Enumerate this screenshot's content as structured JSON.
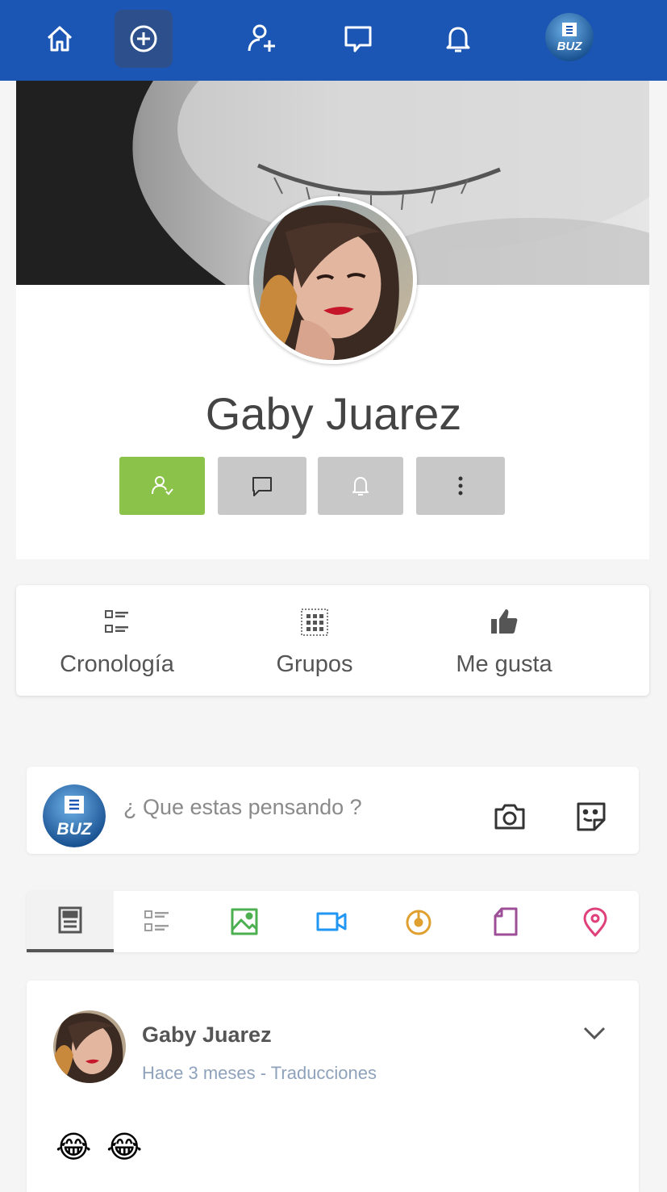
{
  "topbar": {
    "icons": [
      "home-icon",
      "add-circle-icon",
      "add-user-icon",
      "messages-icon",
      "bell-icon",
      "avatar"
    ],
    "accent": "#1c56b4"
  },
  "avatar_logo_text": "BUZ",
  "profile": {
    "name": "Gaby Juarez",
    "actions": [
      {
        "icon": "friend-check-icon",
        "color": "#8bc34a"
      },
      {
        "icon": "message-icon",
        "color": "#c8c8c8"
      },
      {
        "icon": "bell-icon",
        "color": "#c8c8c8"
      },
      {
        "icon": "more-vertical-icon",
        "color": "#c8c8c8"
      }
    ]
  },
  "tabs": [
    {
      "label": "Cronología",
      "icon": "timeline-icon"
    },
    {
      "label": "Grupos",
      "icon": "groups-icon"
    },
    {
      "label": "Me gusta",
      "icon": "thumbs-up-icon"
    }
  ],
  "composer": {
    "placeholder": "¿ Que estas pensando ?",
    "icons": [
      "camera-icon",
      "sticker-icon"
    ]
  },
  "filters": [
    {
      "icon": "all-posts-icon",
      "color": "#555555",
      "active": true
    },
    {
      "icon": "text-list-icon",
      "color": "#9e9e9e"
    },
    {
      "icon": "image-icon",
      "color": "#4caf50"
    },
    {
      "icon": "video-icon",
      "color": "#2196f3"
    },
    {
      "icon": "audio-icon",
      "color": "#e0a030"
    },
    {
      "icon": "file-icon",
      "color": "#9c4f96"
    },
    {
      "icon": "location-icon",
      "color": "#e0407a"
    }
  ],
  "post": {
    "author": "Gaby Juarez",
    "meta": "Hace 3 meses - Traducciones",
    "body": "😂 😂"
  }
}
